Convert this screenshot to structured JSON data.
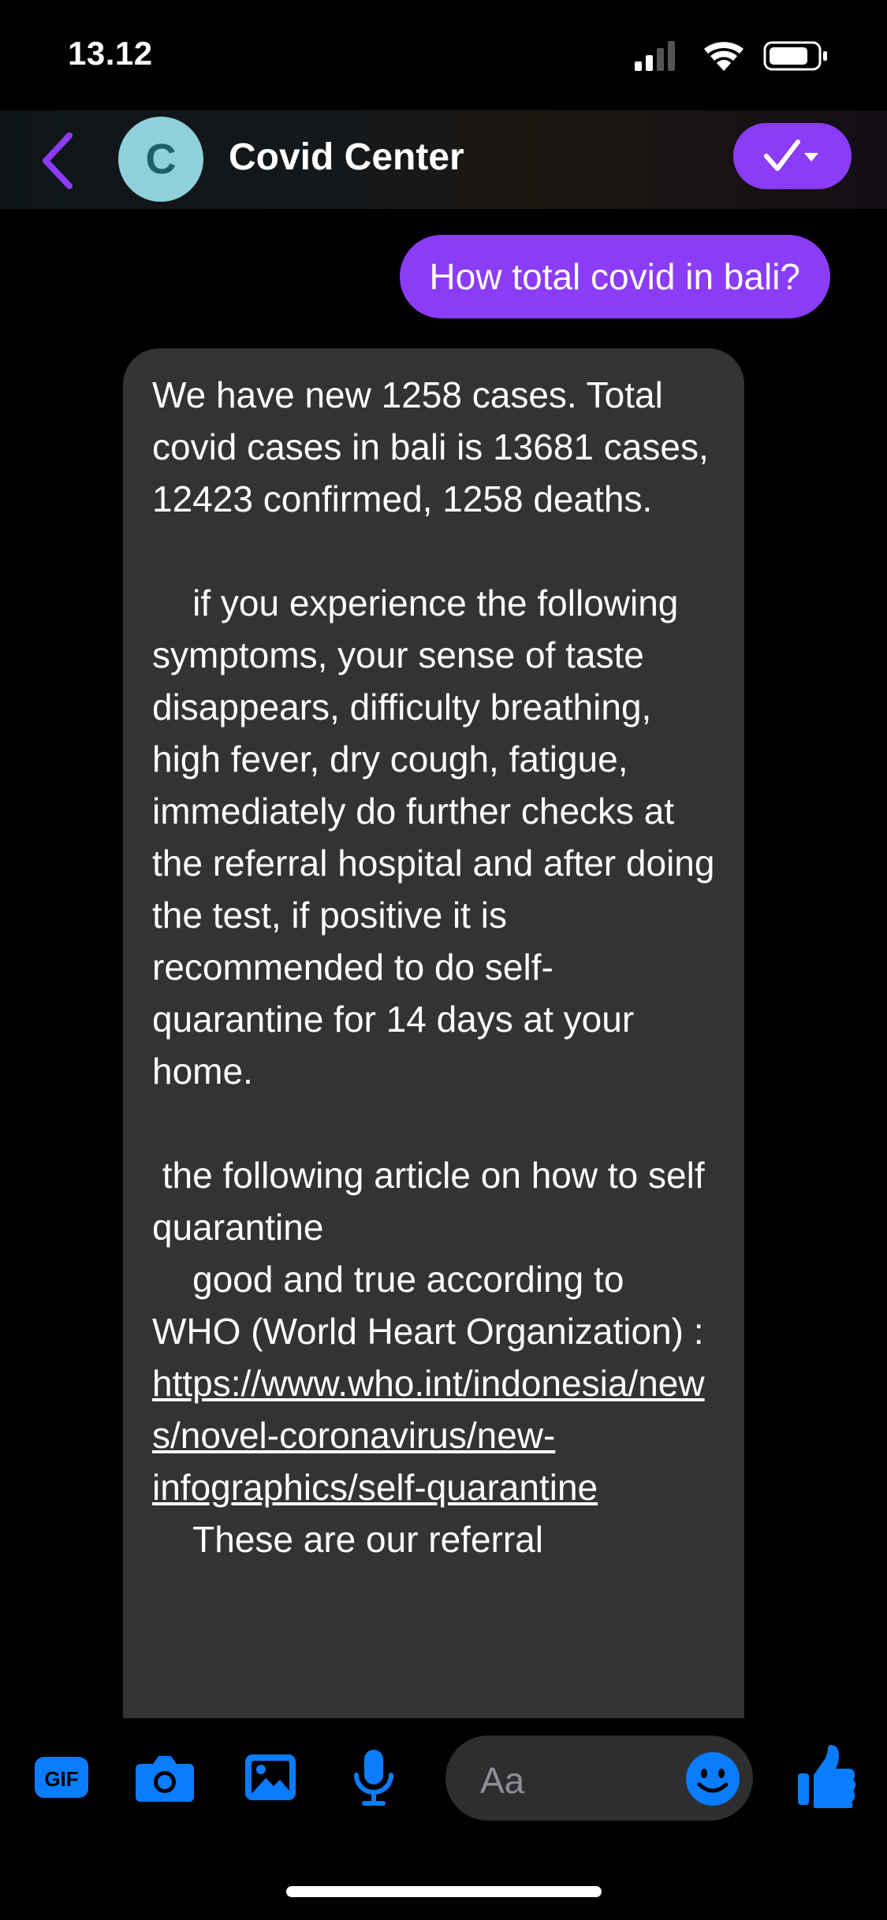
{
  "status_bar": {
    "time": "13.12"
  },
  "header": {
    "contact_name": "Covid Center",
    "avatar_initial": "C",
    "accent_color": "#8b3cf6"
  },
  "messages": {
    "outgoing": "How total covid in bali?",
    "incoming_text_1": "We have new 1258 cases. Total covid cases in bali is 13681 cases, 12423 confirmed, 1258 deaths.\n\n    if you experience the following symptoms, your sense of taste disappears, difficulty breathing, high fever, dry cough, fatigue, immediately do further checks at the referral hospital and after doing the test, if positive it is recommended to do self-quarantine for 14 days at your home.\n\n the following article on how to self quarantine\n    good and true according to WHO (World Heart Organization) : ",
    "incoming_link": "https://www.who.int/indonesia/news/novel-coronavirus/new-infographics/self-quarantine",
    "incoming_text_2": "\n    These are our referral"
  },
  "composer": {
    "placeholder": "Aa",
    "icons": [
      "gif-icon",
      "camera-icon",
      "image-icon",
      "microphone-icon",
      "emoji-icon",
      "thumbs-up-icon"
    ],
    "icon_color": "#0a7cff"
  }
}
